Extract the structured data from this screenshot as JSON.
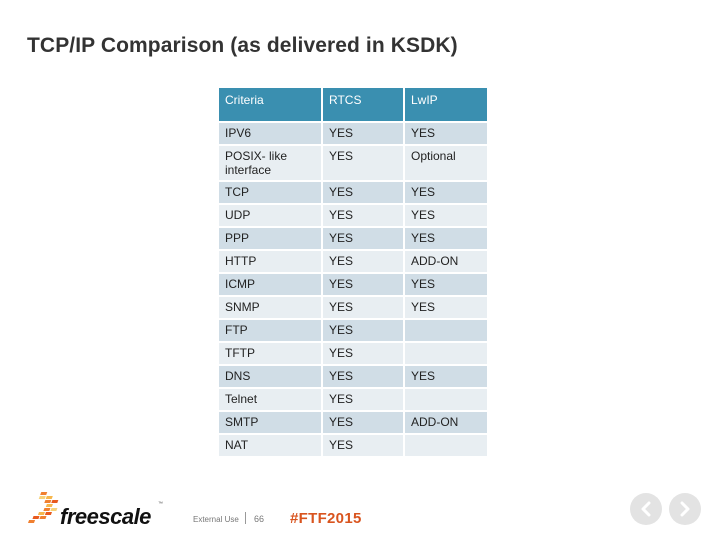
{
  "slide": {
    "title": "TCP/IP Comparison (as delivered in KSDK)"
  },
  "table": {
    "headers": [
      "Criteria",
      "RTCS",
      "LwIP"
    ],
    "rows": [
      [
        "IPV6",
        "YES",
        "YES"
      ],
      [
        "POSIX- like interface",
        "YES",
        "Optional"
      ],
      [
        "TCP",
        "YES",
        "YES"
      ],
      [
        "UDP",
        "YES",
        "YES"
      ],
      [
        "PPP",
        "YES",
        "YES"
      ],
      [
        "HTTP",
        "YES",
        "ADD-ON"
      ],
      [
        "ICMP",
        "YES",
        "YES"
      ],
      [
        "SNMP",
        "YES",
        "YES"
      ],
      [
        "FTP",
        "YES",
        ""
      ],
      [
        "TFTP",
        "YES",
        ""
      ],
      [
        "DNS",
        "YES",
        "YES"
      ],
      [
        "Telnet",
        "YES",
        ""
      ],
      [
        "SMTP",
        "YES",
        "ADD-ON"
      ],
      [
        "NAT",
        "YES",
        ""
      ]
    ]
  },
  "footer": {
    "logo_text": "freescale",
    "logo_tm": "™",
    "classification": "External Use",
    "page_number": "66",
    "hashtag": "#FTF2015",
    "prev_icon": "chevron-left-icon",
    "next_icon": "chevron-right-icon"
  },
  "colors": {
    "header_bg": "#3a8fb0",
    "row_odd": "#d0dde6",
    "row_even": "#e8eef2",
    "hashtag": "#d9541e"
  }
}
